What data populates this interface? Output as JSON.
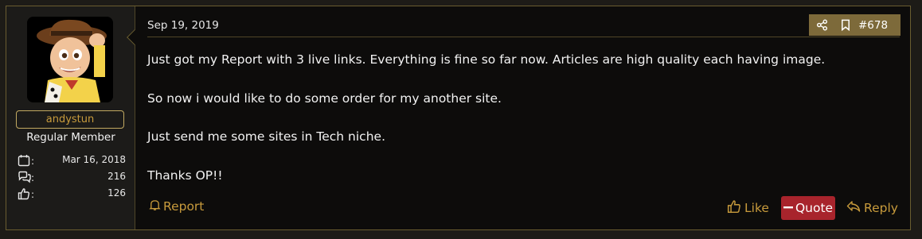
{
  "user": {
    "username": "andystun",
    "role": "Regular Member",
    "joined": "Mar 16, 2018",
    "messages": "216",
    "reactions": "126"
  },
  "post": {
    "date": "Sep 19, 2019",
    "number": "#678",
    "paragraphs": [
      "Just got my Report with 3 live links. Everything is fine so far now. Articles are high quality each having image.",
      "So now i would like to do some order for my another site.",
      "Just send me some sites in Tech niche.",
      "Thanks OP!!"
    ]
  },
  "footer": {
    "report_label": "Report",
    "like_label": "Like",
    "quote_label": "Quote",
    "reply_label": "Reply"
  },
  "colors": {
    "accent": "#c89b3c",
    "quote_bg": "#a8242c",
    "header_actions_bg": "#7d6a3a",
    "border": "#6a5d30"
  },
  "icons": {
    "calendar": "calendar-icon",
    "messages": "comments-icon",
    "reactions": "thumbs-up-icon",
    "share": "share-icon",
    "bookmark": "bookmark-icon",
    "report": "bell-icon",
    "like": "thumbs-up-icon",
    "quote": "minus-icon",
    "reply": "reply-icon"
  }
}
